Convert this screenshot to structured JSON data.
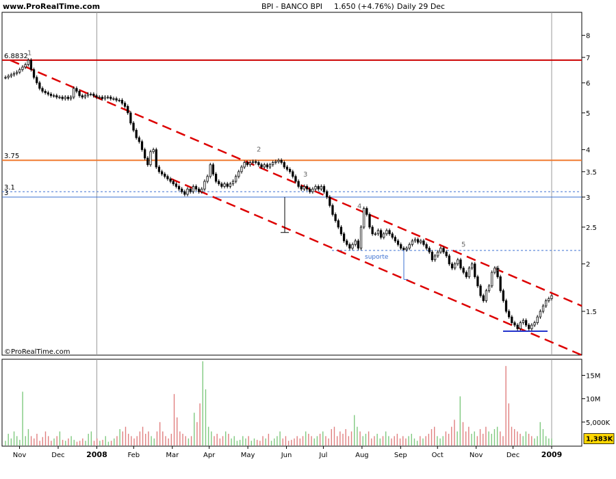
{
  "header": {
    "site": "www.ProRealTime.com",
    "instrument": "BPI - BANCO BPI",
    "last": "1.650 (+4.76%)",
    "period": "Daily 29 Dec"
  },
  "copyright": "©ProRealTime.com",
  "colors": {
    "frame": "#000000",
    "grid": "#999999",
    "candle": "#000000",
    "up_candle": "#2e8b2e",
    "down_candle": "#b22222",
    "resistance_red": "#cc0000",
    "resistance_orange": "#f07a30",
    "support_blue": "#3a6fd1",
    "channel": "#dd0000",
    "volume_up": "#7fc97f",
    "volume_down": "#e07f7f",
    "volume_badge": "#ffd700"
  },
  "chart_data": {
    "type": "candlestick",
    "scale": "log",
    "ylim": [
      1.15,
      9.2
    ],
    "price_ticks": [
      "8",
      "7",
      "6",
      "5",
      "4",
      "3.5",
      "3",
      "2.5",
      "2",
      "1.5"
    ],
    "months": [
      "Nov",
      "Dec",
      "2008",
      "Feb",
      "Mar",
      "Apr",
      "May",
      "Jun",
      "Jul",
      "Aug",
      "Sep",
      "Oct",
      "Nov",
      "Dec",
      "2009"
    ],
    "closes": [
      6.2,
      6.25,
      6.3,
      6.35,
      6.4,
      6.5,
      6.6,
      6.7,
      6.88,
      6.5,
      6.2,
      6.0,
      5.8,
      5.7,
      5.65,
      5.6,
      5.55,
      5.55,
      5.5,
      5.5,
      5.45,
      5.5,
      5.45,
      5.5,
      5.8,
      5.7,
      5.55,
      5.5,
      5.55,
      5.6,
      5.6,
      5.55,
      5.5,
      5.5,
      5.45,
      5.5,
      5.5,
      5.45,
      5.45,
      5.4,
      5.4,
      5.3,
      5.2,
      5.0,
      4.7,
      4.5,
      4.3,
      4.2,
      4.0,
      3.8,
      3.65,
      3.95,
      4.0,
      3.6,
      3.5,
      3.45,
      3.4,
      3.35,
      3.3,
      3.25,
      3.2,
      3.15,
      3.1,
      3.05,
      3.15,
      3.1,
      3.2,
      3.15,
      3.1,
      3.15,
      3.3,
      3.4,
      3.65,
      3.45,
      3.3,
      3.25,
      3.2,
      3.25,
      3.2,
      3.25,
      3.3,
      3.4,
      3.5,
      3.6,
      3.7,
      3.65,
      3.7,
      3.72,
      3.7,
      3.65,
      3.6,
      3.65,
      3.6,
      3.65,
      3.7,
      3.72,
      3.75,
      3.7,
      3.6,
      3.55,
      3.5,
      3.4,
      3.3,
      3.2,
      3.15,
      3.2,
      3.15,
      3.1,
      3.15,
      3.2,
      3.15,
      3.2,
      3.1,
      3.0,
      2.85,
      2.7,
      2.6,
      2.5,
      2.4,
      2.3,
      2.25,
      2.2,
      2.25,
      2.3,
      2.2,
      2.5,
      2.8,
      2.7,
      2.5,
      2.4,
      2.4,
      2.45,
      2.35,
      2.4,
      2.45,
      2.4,
      2.35,
      2.3,
      2.25,
      2.2,
      2.18,
      2.2,
      2.25,
      2.3,
      2.32,
      2.28,
      2.3,
      2.25,
      2.2,
      2.15,
      2.05,
      2.1,
      2.15,
      2.2,
      2.15,
      2.1,
      2.0,
      1.95,
      2.0,
      2.05,
      1.95,
      1.9,
      1.85,
      1.95,
      2.0,
      1.85,
      1.75,
      1.65,
      1.6,
      1.7,
      1.75,
      1.9,
      1.95,
      1.85,
      1.7,
      1.6,
      1.5,
      1.45,
      1.4,
      1.38,
      1.35,
      1.4,
      1.42,
      1.38,
      1.35,
      1.38,
      1.4,
      1.45,
      1.5,
      1.55,
      1.6,
      1.62,
      1.65
    ],
    "volume_mil": [
      1.0,
      2.5,
      1.5,
      3.0,
      2.0,
      1.2,
      11.5,
      2.0,
      3.5,
      2.0,
      1.5,
      2.5,
      1.0,
      1.8,
      3.0,
      2.0,
      1.0,
      1.5,
      2.0,
      3.0,
      1.2,
      1.0,
      1.5,
      2.0,
      1.2,
      0.8,
      1.0,
      1.5,
      1.0,
      2.5,
      3.0,
      1.0,
      1.5,
      1.0,
      1.2,
      2.0,
      0.8,
      1.0,
      1.5,
      2.0,
      3.5,
      3.0,
      4.0,
      2.5,
      2.0,
      1.5,
      2.0,
      3.0,
      4.0,
      2.5,
      3.0,
      2.0,
      1.5,
      3.0,
      5.0,
      3.0,
      2.0,
      1.5,
      2.5,
      11.0,
      6.0,
      3.0,
      2.5,
      2.0,
      1.5,
      2.0,
      7.0,
      5.0,
      9.0,
      18.0,
      12.0,
      4.0,
      3.0,
      2.0,
      2.5,
      1.5,
      2.0,
      3.0,
      2.5,
      1.5,
      2.0,
      1.0,
      1.2,
      2.0,
      1.5,
      2.0,
      1.0,
      1.5,
      1.2,
      1.0,
      2.0,
      1.5,
      2.5,
      1.0,
      1.5,
      2.0,
      3.0,
      1.5,
      2.0,
      1.0,
      1.2,
      1.5,
      2.0,
      1.5,
      2.0,
      3.0,
      2.5,
      2.0,
      1.5,
      2.0,
      2.5,
      3.0,
      2.0,
      1.5,
      3.5,
      4.0,
      2.0,
      3.0,
      2.5,
      3.5,
      2.0,
      3.0,
      6.5,
      4.0,
      3.0,
      2.0,
      2.5,
      3.0,
      1.5,
      2.0,
      2.5,
      1.5,
      2.0,
      3.0,
      2.0,
      1.5,
      2.0,
      2.5,
      1.5,
      2.0,
      1.5,
      2.0,
      2.5,
      1.5,
      1.0,
      2.0,
      1.5,
      2.0,
      2.5,
      3.5,
      4.0,
      2.0,
      1.5,
      2.0,
      3.0,
      2.5,
      4.0,
      5.5,
      3.0,
      10.5,
      5.0,
      3.0,
      4.0,
      2.5,
      3.0,
      2.0,
      3.5,
      2.5,
      4.0,
      3.0,
      2.5,
      3.5,
      4.0,
      3.0,
      2.0,
      17.0,
      9.0,
      4.0,
      3.5,
      3.0,
      2.5,
      2.0,
      3.0,
      2.5,
      2.0,
      1.5,
      2.0,
      5.0,
      3.5,
      2.0,
      1.5,
      1.5
    ],
    "volume_ticks": [
      "15M",
      "10M",
      "5,000K"
    ],
    "volume_ylim": [
      0,
      18
    ],
    "last_volume": "1,383K",
    "resistance_levels": [
      {
        "value": 6.8832,
        "label": "6.8832"
      },
      {
        "value": 3.75,
        "label": "3.75"
      },
      {
        "value": 3.1,
        "label": "3.1"
      },
      {
        "value": 3.0,
        "label": "3"
      }
    ],
    "support_level": 2.17,
    "support_label": "suporte",
    "wave_labels": [
      "1",
      "2",
      "3",
      "4",
      "5",
      "6"
    ]
  }
}
